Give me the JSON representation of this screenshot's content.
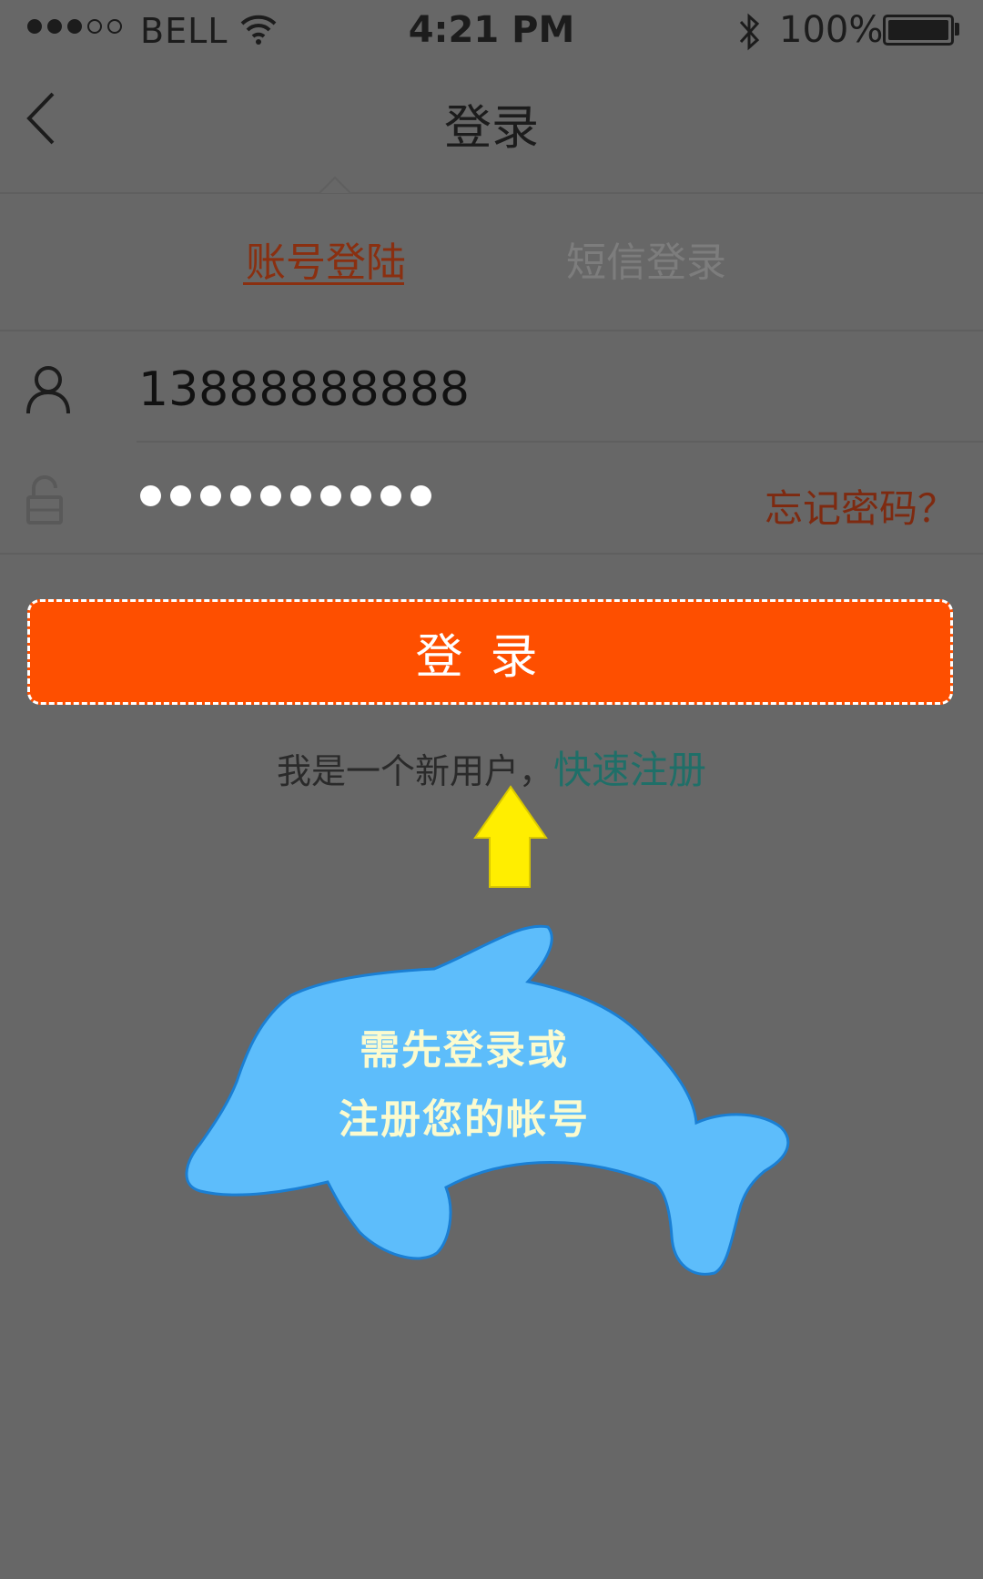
{
  "status_bar": {
    "carrier": "BELL",
    "time": "4:21 PM",
    "battery": "100%"
  },
  "nav": {
    "title": "登录"
  },
  "tabs": [
    {
      "label": "账号登陆",
      "active": true
    },
    {
      "label": "短信登录",
      "active": false
    }
  ],
  "login_form": {
    "account_value": "13888888888",
    "password_mask_count": 10,
    "forgot_label": "忘记密码？",
    "submit_label": "登录"
  },
  "register": {
    "prompt": "我是一个新用户，",
    "link": "快速注册"
  },
  "callout": {
    "line1": "需先登录或",
    "line2": "注册您的帐号"
  },
  "colors": {
    "accent": "#fe4f00",
    "tab_active": "#8a2f10",
    "link": "#1f6f68",
    "overlay_bg": "#676767"
  }
}
